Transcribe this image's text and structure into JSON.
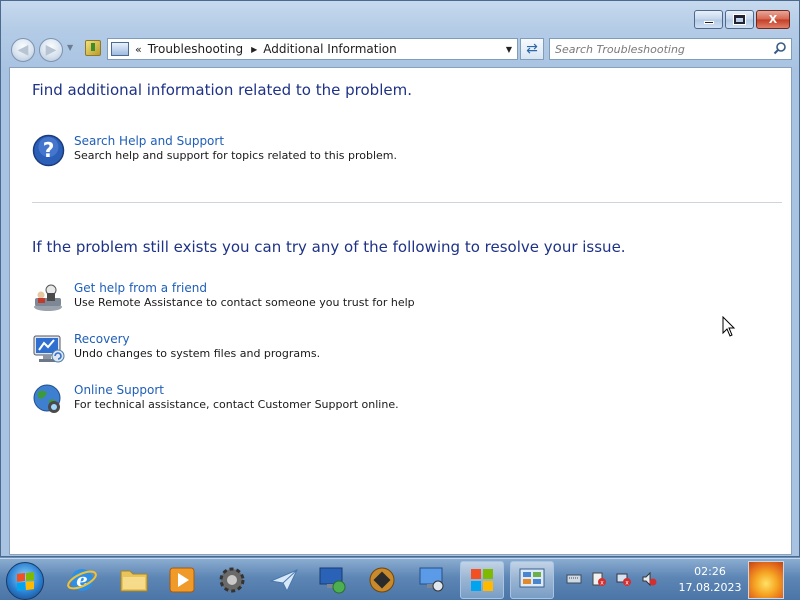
{
  "window": {
    "controls": {
      "minimize": "minimize",
      "maximize": "maximize",
      "close": "X"
    }
  },
  "nav": {
    "breadcrumb": {
      "overflow": "«",
      "items": [
        "Troubleshooting",
        "Additional Information"
      ]
    },
    "search_placeholder": "Search Troubleshooting"
  },
  "content": {
    "heading1": "Find additional information related to the problem.",
    "help": {
      "title": "Search Help and Support",
      "desc": "Search help and support for topics related to this problem."
    },
    "heading2": "If the problem still exists you can try any of the following to resolve your issue.",
    "options": [
      {
        "title": "Get help from a friend",
        "desc": "Use Remote Assistance to contact someone you trust for help",
        "icon": "remote-assistance-icon"
      },
      {
        "title": "Recovery",
        "desc": "Undo changes to system files and programs.",
        "icon": "recovery-icon"
      },
      {
        "title": "Online Support",
        "desc": "For technical assistance, contact Customer Support online.",
        "icon": "globe-icon"
      }
    ]
  },
  "taskbar": {
    "pinned": [
      "internet-explorer-icon",
      "folder-icon",
      "media-player-icon",
      "gear-icon",
      "paper-plane-icon",
      "remote-desktop-icon",
      "chess-icon",
      "computer-search-icon",
      "windows-flag-icon",
      "control-panel-icon"
    ],
    "tray": [
      "keyboard-icon",
      "action-center-icon",
      "network-icon",
      "volume-muted-icon"
    ],
    "clock": {
      "time": "02:26",
      "date": "17.08.2023"
    }
  },
  "colors": {
    "link": "#1e5eb9",
    "heading": "#1e3287",
    "taskbar": "#5d86b5"
  }
}
